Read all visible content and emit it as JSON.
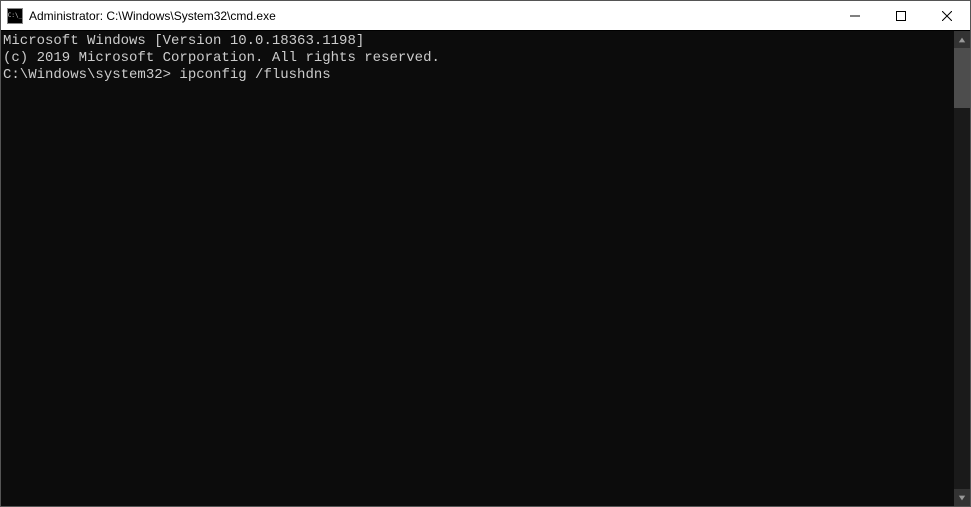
{
  "window": {
    "title": "Administrator: C:\\Windows\\System32\\cmd.exe"
  },
  "terminal": {
    "line1": "Microsoft Windows [Version 10.0.18363.1198]",
    "line2": "(c) 2019 Microsoft Corporation. All rights reserved.",
    "blank": "",
    "prompt": "C:\\Windows\\system32>",
    "command": " ipconfig /flushdns"
  }
}
